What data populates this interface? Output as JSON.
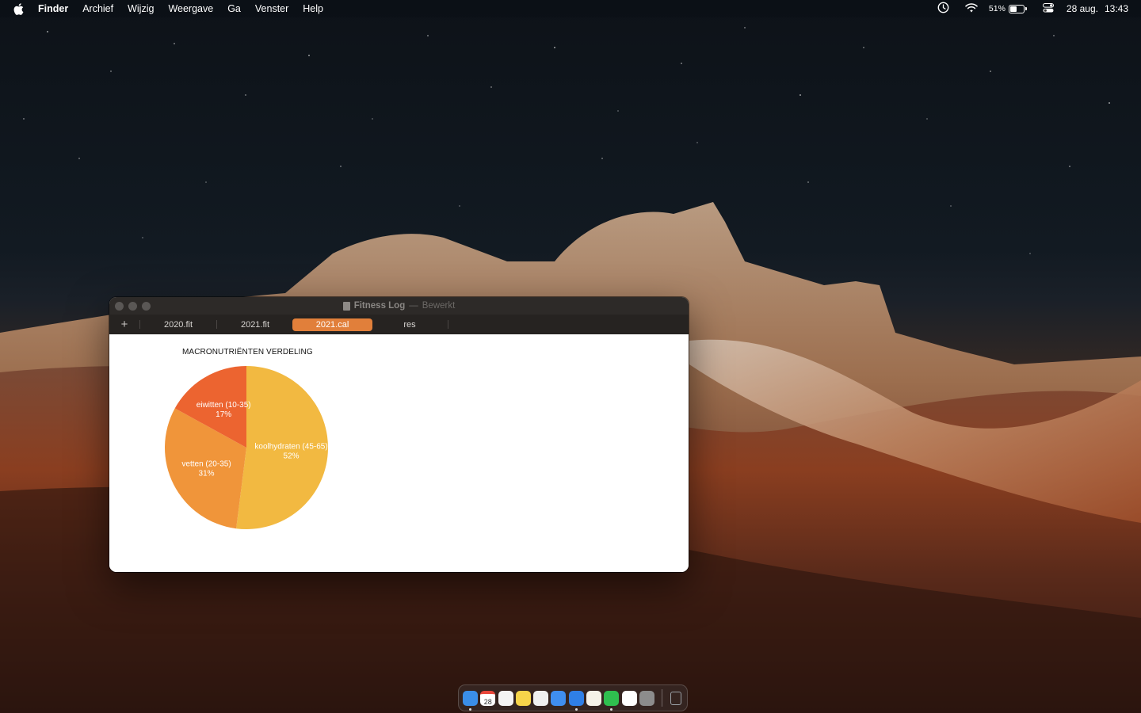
{
  "menubar": {
    "app_name": "Finder",
    "items": [
      "Archief",
      "Wijzig",
      "Weergave",
      "Ga",
      "Venster",
      "Help"
    ],
    "battery_percent": "51%",
    "date": "28 aug.",
    "time": "13:43",
    "icons": [
      "apple-icon",
      "clock-icon",
      "wifi-icon",
      "battery-icon",
      "control-center-icon"
    ]
  },
  "window": {
    "title": "Fitness Log",
    "separator": "—",
    "status": "Bewerkt",
    "tabs": [
      {
        "label": "2020.fit",
        "active": false
      },
      {
        "label": "2021.fit",
        "active": false
      },
      {
        "label": "2021.cal",
        "active": true
      },
      {
        "label": "res",
        "active": false
      }
    ],
    "add_tab_label": "+"
  },
  "chart_data": {
    "type": "pie",
    "title": "MACRONUTRIËNTEN VERDELING",
    "slices": [
      {
        "label": "koolhydraten (45-65)",
        "percent_label": "52%",
        "value": 52,
        "color": "#f2b941"
      },
      {
        "label": "vetten (20-35)",
        "percent_label": "31%",
        "value": 31,
        "color": "#f0953a"
      },
      {
        "label": "eiwitten (10-35)",
        "percent_label": "17%",
        "value": 17,
        "color": "#ec6430"
      }
    ]
  },
  "dock": {
    "apps": [
      {
        "name": "finder-icon",
        "color": "#3a8ee8",
        "running": true
      },
      {
        "name": "calendar-icon",
        "color": "#ffffff",
        "running": false,
        "text": "28"
      },
      {
        "name": "reminders-icon",
        "color": "#f4f4f4",
        "running": false
      },
      {
        "name": "notes-icon",
        "color": "#f7d44a",
        "running": false
      },
      {
        "name": "photos-icon",
        "color": "#f0f0f0",
        "running": false
      },
      {
        "name": "mail-icon",
        "color": "#3f8ef0",
        "running": false
      },
      {
        "name": "safari-icon",
        "color": "#2f7fe6",
        "running": true
      },
      {
        "name": "textedit-icon",
        "color": "#f5f2e8",
        "running": false
      },
      {
        "name": "numbers-icon",
        "color": "#2fbf4f",
        "running": true
      },
      {
        "name": "pages-icon",
        "color": "#ffffff",
        "running": false
      },
      {
        "name": "system-preferences-icon",
        "color": "#8c8c8c",
        "running": false
      }
    ],
    "trash": {
      "name": "trash-icon",
      "color": "#9aa0a6"
    }
  }
}
